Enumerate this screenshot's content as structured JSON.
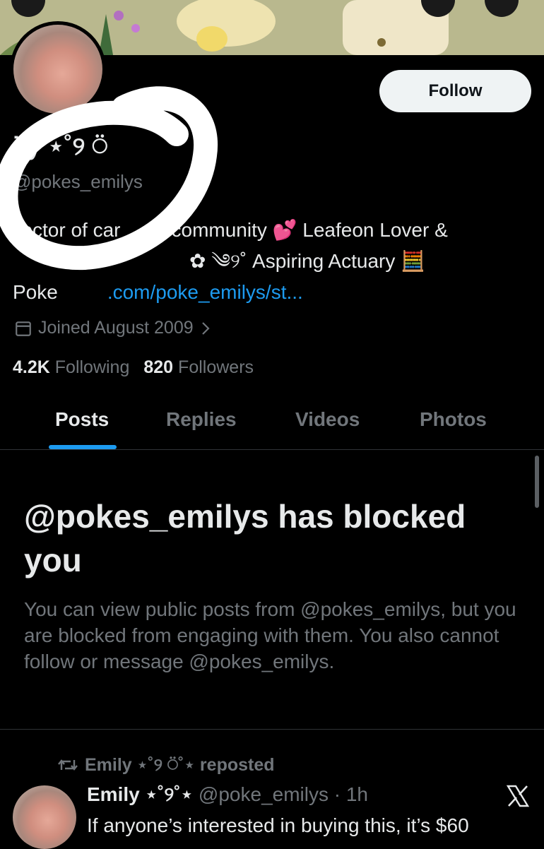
{
  "profile": {
    "name": "Emily ⋆˚୨ ⍥",
    "name_visible": "ily ⋆˚୨ ⍥",
    "handle": "@pokes_emilys",
    "follow_label": "Follow",
    "bio_line1": "llector of car",
    "bio_line1b": "community 💕 Leafeon Lover &",
    "bio_line2": "✿ ༄୨˚ Aspiring Actuary 🧮",
    "bio_line3_prefix": "Poke",
    "bio_link": ".com/poke_emilys/st...",
    "joined": "Joined August 2009",
    "following_count": "4.2K",
    "following_label": "Following",
    "followers_count": "820",
    "followers_label": "Followers"
  },
  "tabs": [
    {
      "label": "Posts",
      "active": true
    },
    {
      "label": "Replies",
      "active": false
    },
    {
      "label": "Videos",
      "active": false
    },
    {
      "label": "Photos",
      "active": false
    }
  ],
  "blocked": {
    "title": "@pokes_emilys has blocked you",
    "description": "You can view public posts from @pokes_emilys, but you are blocked from engaging with them. You also cannot follow or message @pokes_emilys."
  },
  "post": {
    "repost_label": "Emily ⋆˚୨ ⍥˚⋆ reposted",
    "author": "Emily ⋆˚୨˚⋆",
    "meta": "@poke_emilys · 1h",
    "text": "If anyone’s interested in buying this, it’s $60"
  },
  "colors": {
    "accent": "#1d9bf0",
    "background": "#000000",
    "secondary_text": "#71767b"
  },
  "icons": {
    "calendar": "calendar-icon",
    "chevron": "chevron-right-icon",
    "repost": "repost-icon",
    "x_logo": "x-logo-icon"
  }
}
